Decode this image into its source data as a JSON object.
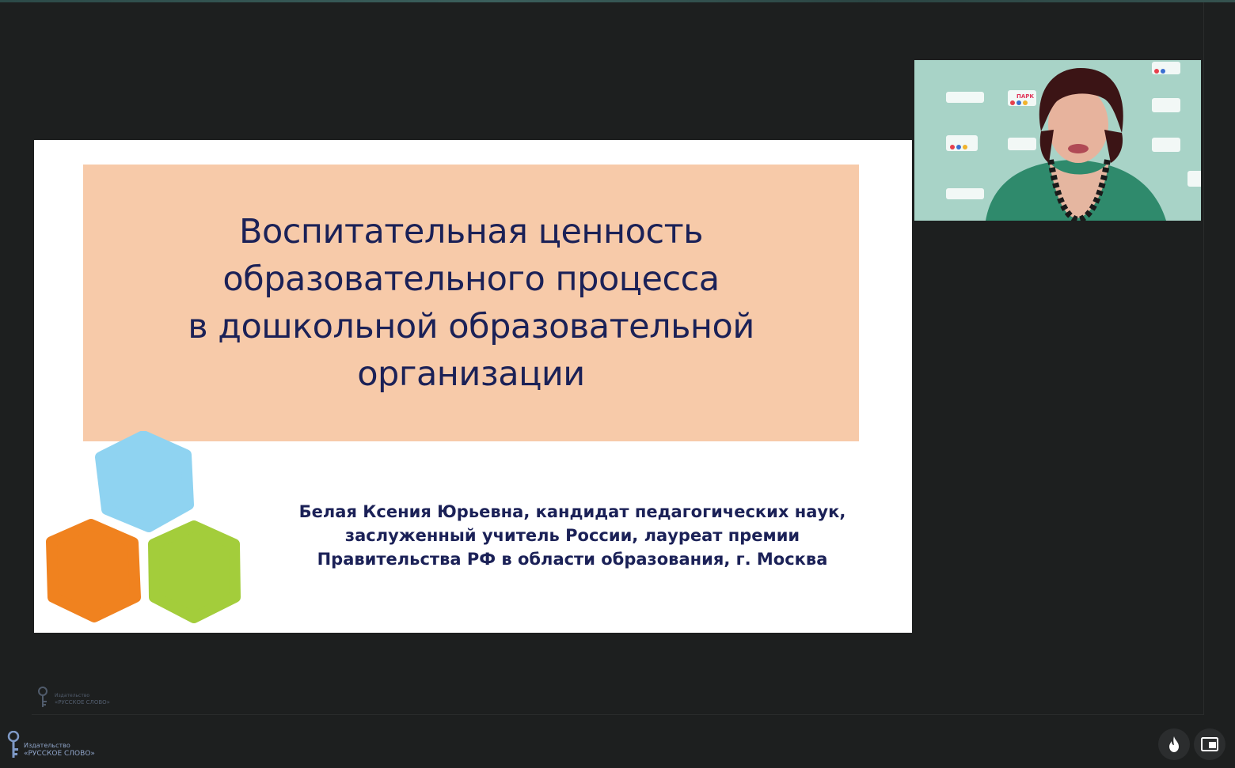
{
  "slide": {
    "title": "Воспитательная ценность\nобразовательного процесса\nв дошкольной образовательной\nорганизации",
    "author": "Белая Ксения Юрьевна, кандидат педагогических наук,\nзаслуженный учитель России, лауреат премии\nПравительства РФ в области образования, г. Москва"
  },
  "webcam": {
    "backdrop_brand": "ПАРК"
  },
  "watermark": {
    "line1": "Издательство",
    "line2": "«РУССКОЕ СЛОВО»"
  },
  "colors": {
    "title_box": "#f7caa9",
    "title_text": "#1b2157",
    "hex_blue": "#8fd3f1",
    "hex_orange": "#f0821f",
    "hex_green": "#a3cd3b"
  },
  "icons": {
    "fire_button": "fire-icon",
    "pip_button": "picture-in-picture-icon"
  }
}
